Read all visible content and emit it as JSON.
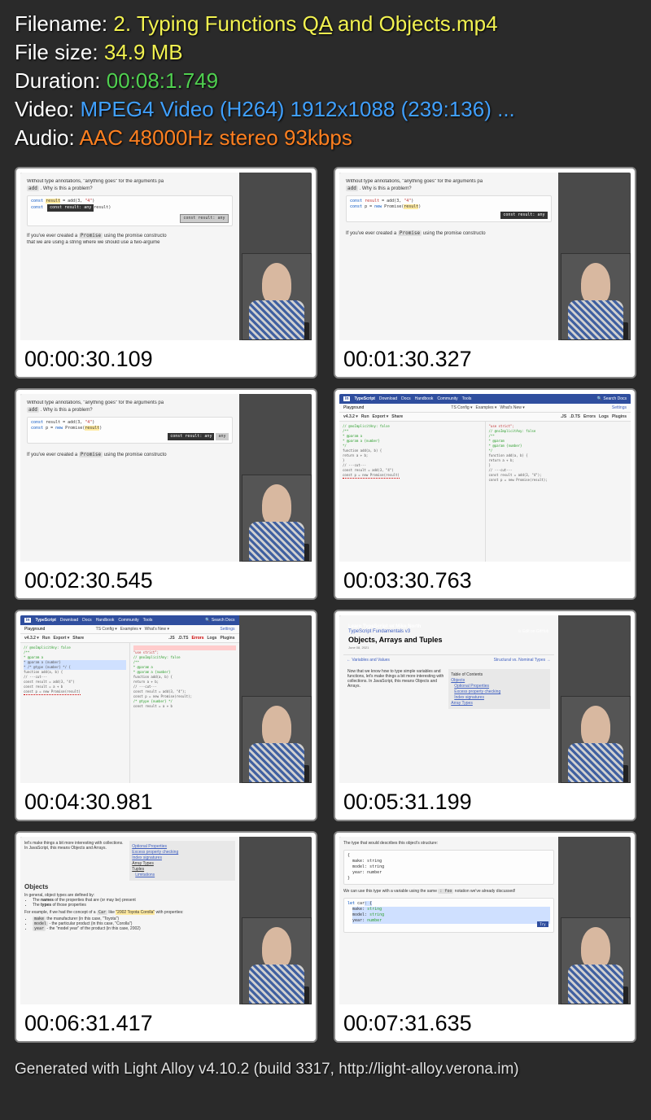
{
  "info": {
    "filename_label": "Filename: ",
    "filename_pre": "2. Typing Functions Q",
    "filename_A": "A",
    "filename_post": " and Objects.mp4",
    "filesize_label": "File size: ",
    "filesize": "34.9 MB",
    "duration_label": "Duration: ",
    "duration": "00:08:1.749",
    "video_label": "Video: ",
    "video": "MPEG4 Video (H264) 1912x1088 (239:136) ...",
    "audio_label": "Audio: ",
    "audio": "AAC 48000Hz stereo 93kbps"
  },
  "thumbs": [
    {
      "ts": "00:00:30.109",
      "type": "doc"
    },
    {
      "ts": "00:01:30.327",
      "type": "doc2"
    },
    {
      "ts": "00:02:30.545",
      "type": "doc3"
    },
    {
      "ts": "00:03:30.763",
      "type": "playground"
    },
    {
      "ts": "00:04:30.981",
      "type": "playground2"
    },
    {
      "ts": "00:05:31.199",
      "type": "course"
    },
    {
      "ts": "00:06:31.417",
      "type": "objects"
    },
    {
      "ts": "00:07:31.635",
      "type": "types"
    }
  ],
  "slide": {
    "para1": "Without type annotations, \"anything goes\" for the arguments pa",
    "add": "add",
    "para1b": ". Why is this a problem?",
    "code1_line1_a": "const ",
    "code1_line1_b": "result",
    "code1_line1_c": " = add(3, ",
    "code1_line1_d": "\"4\"",
    "code1_line1_e": ")",
    "code1_line2_a": "const ",
    "code1_line2_b": "p",
    "code1_line2_c": " = ",
    "code1_line2_d": "new",
    "code1_line2_e": " Promise(",
    "code1_line2_f": "result",
    "code1_line2_g": ")",
    "tooltip1": "const result: any",
    "tooltip2": "const result: any",
    "para2_a": "If you've ever created a ",
    "para2_promise": "Promise",
    "para2_b": " using the promise constructo",
    "para3": "that we are using a string where we should use a two-argume"
  },
  "ts_play": {
    "brand": "TypeScript",
    "nav": [
      "Download",
      "Docs",
      "Handbook",
      "Community",
      "Tools"
    ],
    "search": "Search Docs",
    "playground": "Playground",
    "sub": [
      "TS Config ▾",
      "Examples ▾",
      "What's New ▾"
    ],
    "ver": "v4.3.2 ▾",
    "actions": [
      "Run",
      "Export ▾",
      "Share"
    ],
    "right_tabs": [
      ".JS",
      ".D.TS",
      "Errors",
      "Logs",
      "Plugins"
    ],
    "settings": "Settings",
    "right_settings": "Settings",
    "left_code": [
      "// @noImplicitAny: false",
      "/**",
      " * @param a",
      " * @param a {number}",
      " */",
      "function add(a, b) {",
      "  return a + b;",
      "}",
      "",
      "// ---cut---",
      "const result = add(3, \"4\")",
      "const p = new Promise(result)"
    ],
    "right_code": [
      "\"use strict\";",
      "// @noImplicitAny: false",
      "/**",
      " * @param",
      " * @param {number}",
      " */",
      "function add(a, b) {",
      "    return a + b;",
      "}",
      "// ---cut---",
      "const result = add(3, \"4\");",
      "const p = new Promise(result);",
      "//"
    ],
    "right_code2": [
      "\"use strict\";",
      "// @noImplicitAny: false",
      "/**",
      " * @param a",
      " * @param a {number}",
      " */",
      "function add(a, b) {",
      "    return a + b;",
      "}",
      "// ---cut---",
      "const result = add(3, \"4\");",
      "const p = new Promise(result);",
      "",
      "/* @type {number} */",
      "const result = a + b"
    ],
    "left_code2": [
      "// @noImplicitAny: false",
      "/**",
      " * @param a",
      " * @param a {number}",
      " * /* @type {number} */ {",
      " *",
      " */",
      "function add(a, b) {",
      "",
      "",
      "// ---cut---",
      "const result = add(3, \"4\")",
      "const result = a + b",
      "const p = new Promise(result)",
      "//"
    ]
  },
  "course": {
    "breadcrumb": "Learn TypeScript w/ Mike North",
    "subtitle": "TypeScript Fundamentals v3",
    "title": "Objects, Arrays and Tuples",
    "date": "June 08, 2021",
    "edit": "Edit on GitHub",
    "nav_prev": "← Variables and Values",
    "nav_next": "Structural vs. Nominal Types →",
    "intro": "Now that we know how to type simple variables and functions, let's make things a bit more interesting with collections. In JavaScript, this means Objects and Arrays.",
    "toc_title": "Table of Contents",
    "toc": [
      "Objects",
      "Optional Properties",
      "Excess property checking",
      "Index signatures",
      "Array Types"
    ]
  },
  "objects": {
    "para": "let's make things a bit more interesting with collections. In JavaScript, this means Objects and Arrays.",
    "heading": "Objects",
    "p1": "In general, object types are defined by:",
    "b1_a": "The ",
    "b1_b": "names",
    "b1_c": " of the properties that are (or may be) present",
    "b2_a": "The ",
    "b2_b": "types",
    "b2_c": " of those properties",
    "p2_a": "For example, if we had the concept of a ",
    "p2_car": "Car",
    "p2_b": " like ",
    "p2_hl": "\"2002 Toyota Corolla\"",
    "p2_c": " with properties:",
    "b3_a": "make",
    "b3_b": " the manufacturer (in this case, \"Toyota\")",
    "b4_a": "model",
    "b4_b": " - the particular product (in this case, \"Corolla\")",
    "b5_a": "year",
    "b5_b": " - the \"model year\" of the product (in this case, 2002)",
    "toc2": [
      "Optional Properties",
      "Excess property checking",
      "Index signatures"
    ],
    "toc2b": "Array Types",
    "toc2c": "Tuples",
    "toc2d": "Limitations"
  },
  "types": {
    "p1": "The type that would describes this object's structure:",
    "code1": [
      "make: string",
      "model: string",
      "year: number"
    ],
    "p2_a": "We can use this type with a variable using the same ",
    "p2_foo": ": foo",
    "p2_b": " notation we've already discussed!",
    "code2_a": "let car: {",
    "code2_b": "  make: string",
    "code2_c": "  model: string",
    "code2_d": "  year: number",
    "try": "Try"
  },
  "footer": "Generated with Light Alloy v4.10.2 (build 3317, http://light-alloy.verona.im)"
}
